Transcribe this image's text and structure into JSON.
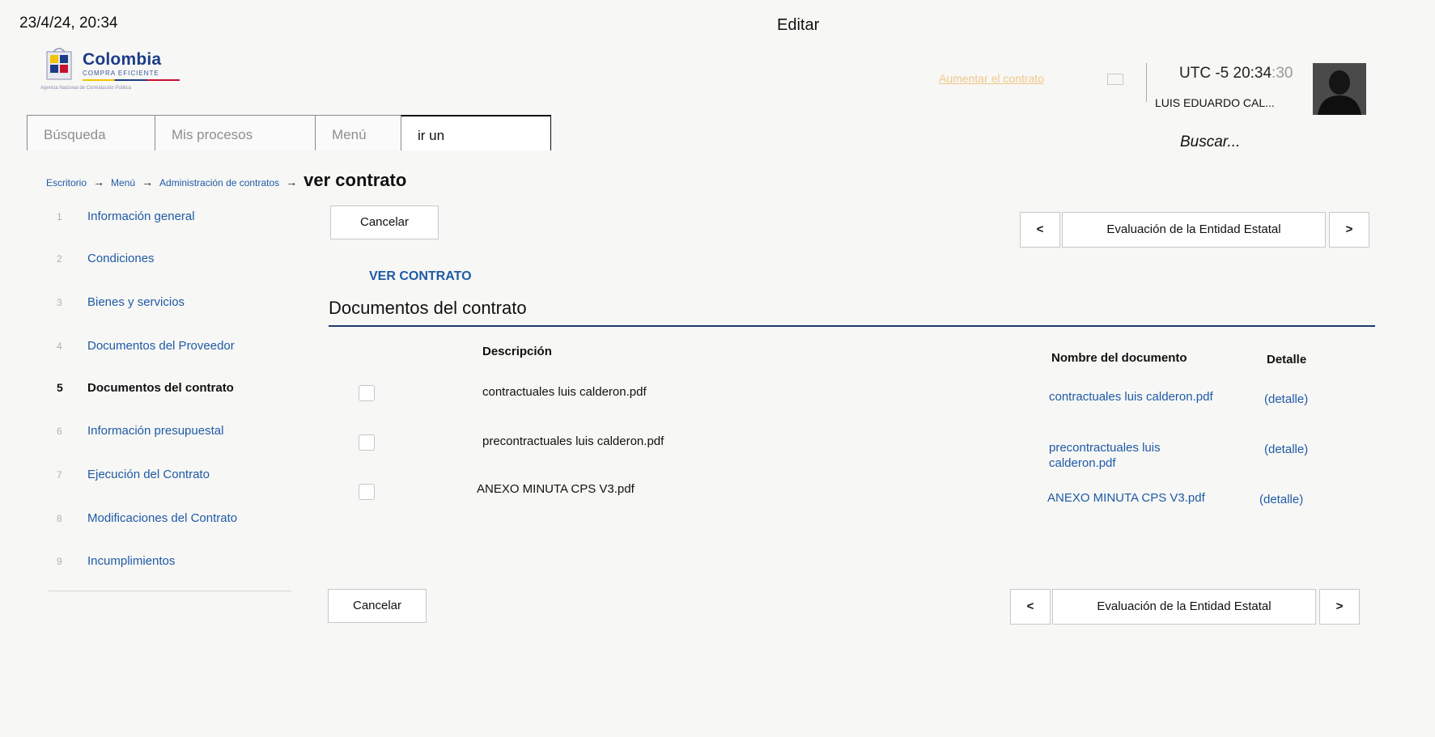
{
  "print_header": {
    "date": "23/4/24, 20:34",
    "title": "Editar"
  },
  "logo": {
    "name": "Colombia",
    "subtitle": "COMPRA EFICIENTE",
    "tagline": "Agencia Nacional de Contratación Pública"
  },
  "header": {
    "faint_link": "Aumentar el contrato",
    "clock_prefix": "UTC -5 ",
    "clock_hm": "20:34",
    "clock_sec": ":30",
    "user": "LUIS EDUARDO CAL...",
    "search_link": "Buscar..."
  },
  "nav": {
    "tabs": [
      "Búsqueda",
      "Mis procesos",
      "Menú"
    ],
    "goto_value": "ir un"
  },
  "breadcrumb": {
    "items": [
      "Escritorio",
      "Menú",
      "Administración de contratos"
    ],
    "current": "ver contrato"
  },
  "steps": [
    {
      "num": "1",
      "label": "Información general"
    },
    {
      "num": "2",
      "label": "Condiciones"
    },
    {
      "num": "3",
      "label": "Bienes y servicios"
    },
    {
      "num": "4",
      "label": "Documentos del Proveedor"
    },
    {
      "num": "5",
      "label": "Documentos del contrato"
    },
    {
      "num": "6",
      "label": "Información presupuestal"
    },
    {
      "num": "7",
      "label": "Ejecución del Contrato"
    },
    {
      "num": "8",
      "label": "Modificaciones del Contrato"
    },
    {
      "num": "9",
      "label": "Incumplimientos"
    }
  ],
  "actions": {
    "cancel": "Cancelar",
    "prev": "<",
    "next": ">",
    "pager_label": "Evaluación de la Entidad Estatal"
  },
  "section": {
    "kicker": "VER CONTRATO",
    "title": "Documentos del contrato"
  },
  "table": {
    "headers": {
      "description": "Descripción",
      "document_name": "Nombre del documento",
      "detail": "Detalle"
    },
    "rows": [
      {
        "description": "contractuales luis calderon.pdf",
        "document": "contractuales luis calderon.pdf",
        "detail": "(detalle)"
      },
      {
        "description": "precontractuales luis calderon.pdf",
        "document": "precontractuales luis calderon.pdf",
        "detail": "(detalle)"
      },
      {
        "description": "ANEXO MINUTA CPS V3.pdf",
        "document": "ANEXO MINUTA CPS V3.pdf",
        "detail": "(detalle)"
      }
    ]
  }
}
